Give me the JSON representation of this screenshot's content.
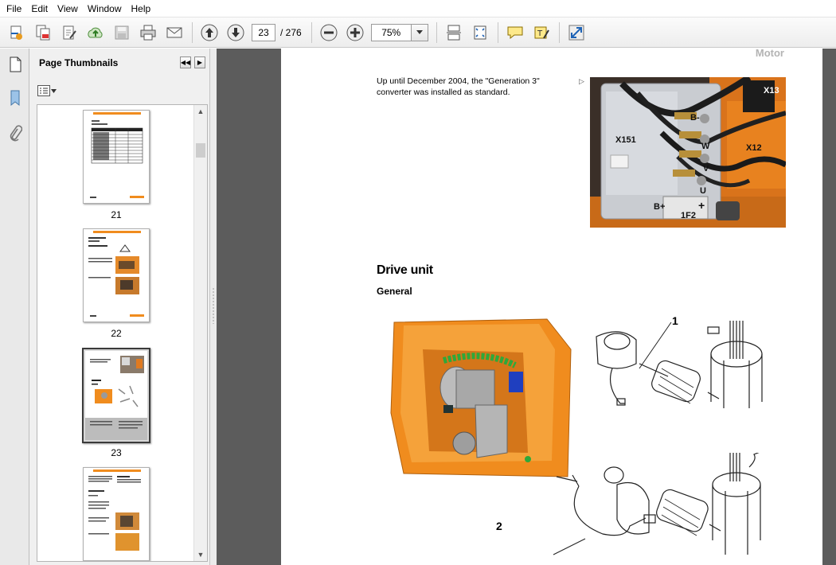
{
  "menu": {
    "items": [
      "File",
      "Edit",
      "View",
      "Window",
      "Help"
    ]
  },
  "toolbar": {
    "current_page": "23",
    "total_pages": "/ 276",
    "zoom": "75%"
  },
  "thumbnails": {
    "title": "Page Thumbnails",
    "pages": [
      {
        "label": "21"
      },
      {
        "label": "22"
      },
      {
        "label": "23",
        "selected": true
      },
      {
        "label": ""
      }
    ]
  },
  "document": {
    "running_head": "Motor",
    "intro_text": "Up until December 2004, the \"Generation 3\" converter was installed as standard.",
    "photo_labels": {
      "x13": "X13",
      "x151": "X151",
      "x12": "X12",
      "b_minus": "B-",
      "w": "W",
      "v": "V",
      "u": "U",
      "b_plus": "B+",
      "f2": "1F2",
      "plus": "+"
    },
    "heading": "Drive unit",
    "subheading": "General",
    "callouts": {
      "one": "1",
      "two": "2"
    }
  },
  "colors": {
    "orange": "#f08c1e",
    "toolbar_bg": "#ededed",
    "doc_bg": "#5c5c5c"
  }
}
